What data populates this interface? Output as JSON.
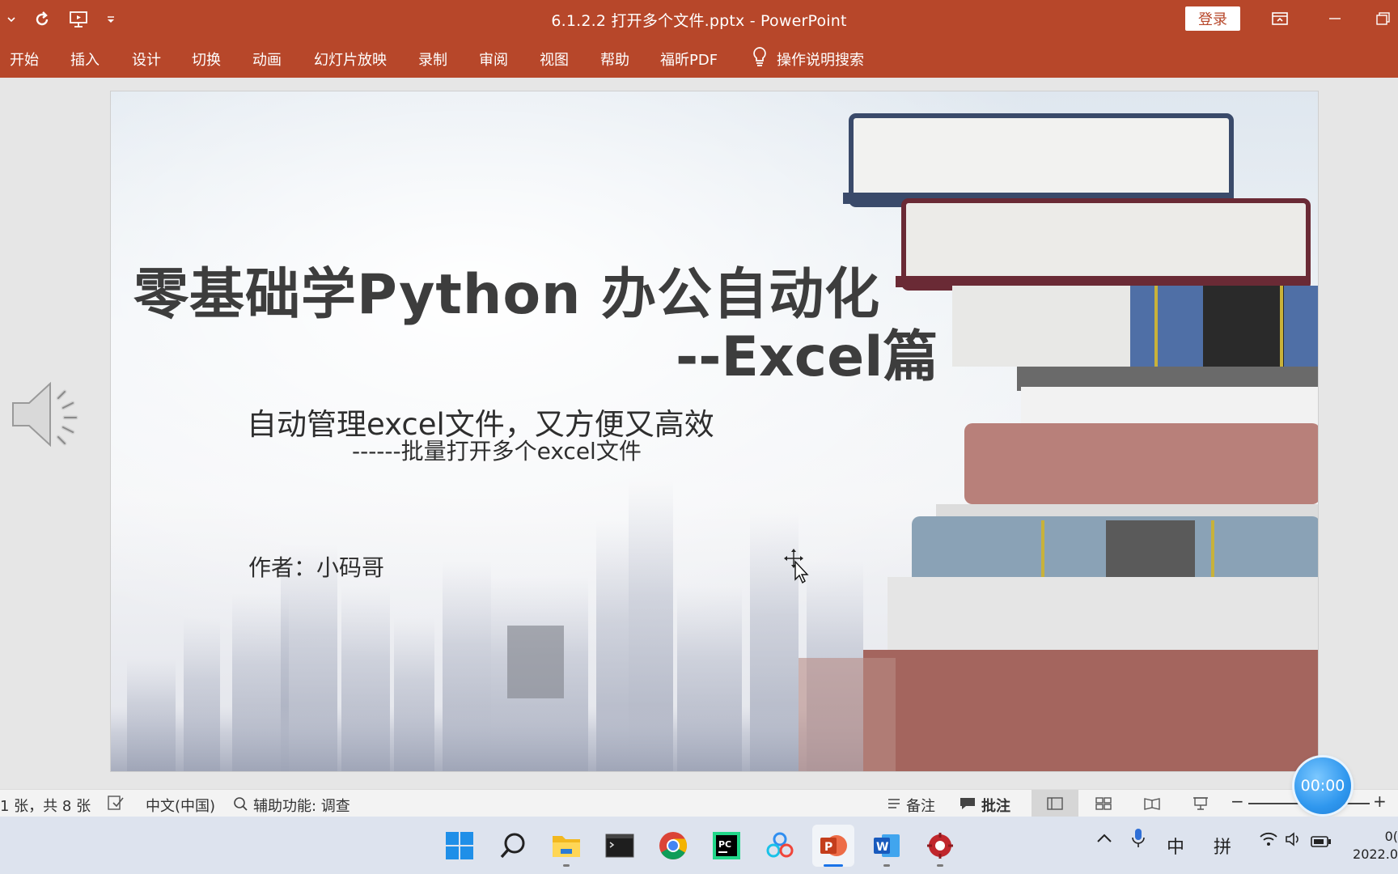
{
  "window": {
    "title": "6.1.2.2 打开多个文件.pptx  -  PowerPoint",
    "login_label": "登录"
  },
  "ribbon": {
    "tabs": [
      "开始",
      "插入",
      "设计",
      "切换",
      "动画",
      "幻灯片放映",
      "录制",
      "审阅",
      "视图",
      "帮助",
      "福昕PDF"
    ],
    "tell_me": "操作说明搜索"
  },
  "slide": {
    "title": "零基础学Python 办公自动化",
    "subtitle": "--Excel篇",
    "line1": "自动管理excel文件，又方便又高效",
    "line2": "------批量打开多个excel文件",
    "author": "作者：小码哥"
  },
  "status": {
    "slide_count": "1 张，共 8 张",
    "language": "中文(中国)",
    "accessibility": "辅助功能: 调查",
    "notes": "备注",
    "comments": "批注",
    "timer": "00:00"
  },
  "taskbar": {
    "ime_lang": "中",
    "ime_mode": "拼",
    "clock_time": "0(",
    "clock_date": "2022.0"
  },
  "colors": {
    "accent": "#b7472a",
    "taskbar": "#dde3ee"
  }
}
